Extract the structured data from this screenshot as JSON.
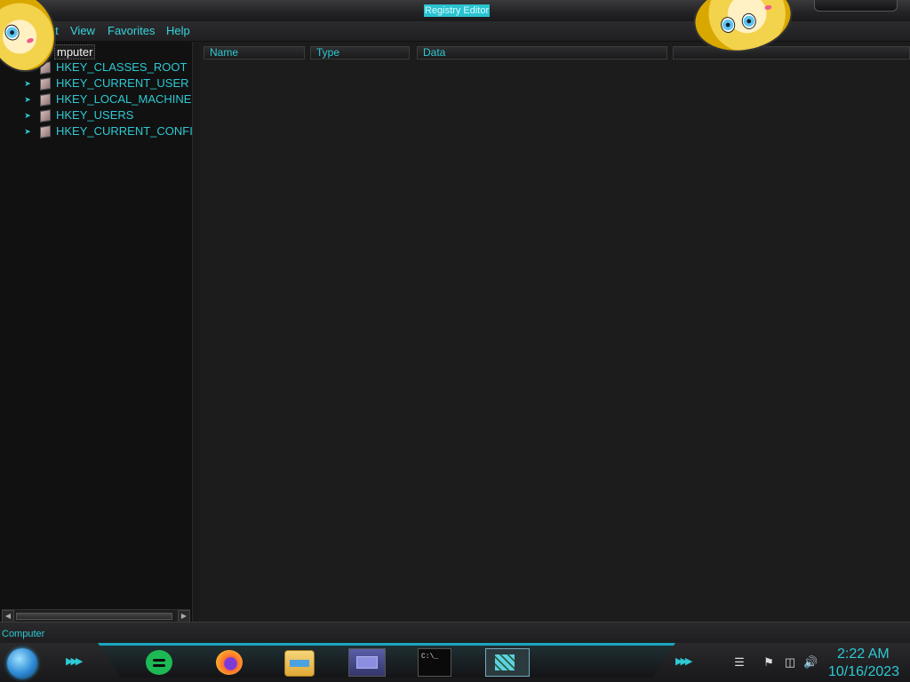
{
  "window": {
    "title": "Registry Editor"
  },
  "menubar": {
    "items": [
      "dit",
      "View",
      "Favorites",
      "Help"
    ]
  },
  "tree": {
    "root_label": "mputer",
    "nodes": [
      {
        "label": "HKEY_CLASSES_ROOT",
        "icon": "folder-icon"
      },
      {
        "label": "HKEY_CURRENT_USER",
        "icon": "folder-icon"
      },
      {
        "label": "HKEY_LOCAL_MACHINE",
        "icon": "folder-icon"
      },
      {
        "label": "HKEY_USERS",
        "icon": "folder-icon"
      },
      {
        "label": "HKEY_CURRENT_CONFI",
        "icon": "folder-icon"
      }
    ]
  },
  "listview": {
    "columns": [
      "Name",
      "Type",
      "Data",
      ""
    ]
  },
  "statusbar": {
    "path": "Computer"
  },
  "taskbar": {
    "pinned": [
      {
        "name": "spotify-icon"
      },
      {
        "name": "firefox-icon"
      },
      {
        "name": "file-explorer-icon"
      },
      {
        "name": "window-app-icon"
      },
      {
        "name": "command-prompt-icon"
      },
      {
        "name": "registry-editor-icon"
      }
    ],
    "tray": {
      "icons": [
        "flag-icon",
        "network-icon",
        "volume-icon"
      ],
      "time": "2:22 AM",
      "date": "10/16/2023"
    }
  },
  "colors": {
    "accent": "#2ec9d3",
    "background": "#1b1b1b",
    "taskbar_highlight": "#1aa6bf"
  }
}
